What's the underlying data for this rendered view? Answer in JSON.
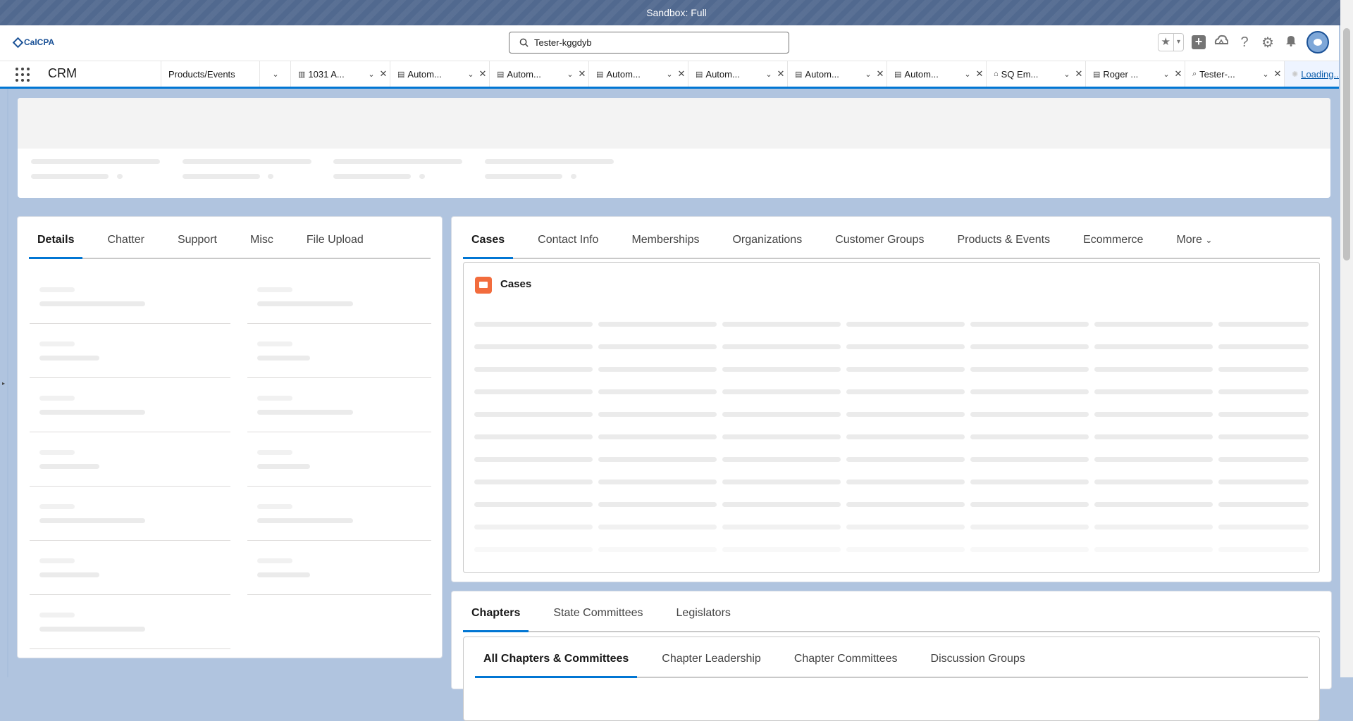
{
  "sandbox_banner": "Sandbox: Full",
  "header": {
    "logo_text": "CalCPA",
    "search_value": "Tester-kggdyb",
    "icons": [
      "favorites-star-icon",
      "favorites-dropdown-icon",
      "global-actions-plus-icon",
      "trailhead-icon",
      "help-icon",
      "setup-gear-icon",
      "notifications-bell-icon",
      "user-avatar"
    ]
  },
  "nav": {
    "app_name": "CRM",
    "nav_item": "Products/Events",
    "tabs": [
      {
        "label": "1031 A...",
        "icon": "building-icon"
      },
      {
        "label": "Autom...",
        "icon": "contact-card-icon"
      },
      {
        "label": "Autom...",
        "icon": "contact-card-icon"
      },
      {
        "label": "Autom...",
        "icon": "contact-card-icon"
      },
      {
        "label": "Autom...",
        "icon": "contact-card-icon"
      },
      {
        "label": "Autom...",
        "icon": "contact-card-icon"
      },
      {
        "label": "Autom...",
        "icon": "contact-card-icon"
      },
      {
        "label": "SQ Em...",
        "icon": "store-icon"
      },
      {
        "label": "Roger ...",
        "icon": "contact-card-icon"
      },
      {
        "label": "Tester-...",
        "icon": "search-icon"
      }
    ],
    "loading_tab": "Loading..."
  },
  "details_card": {
    "tabs": [
      "Details",
      "Chatter",
      "Support",
      "Misc",
      "File Upload"
    ],
    "active_tab": "Details"
  },
  "related_card": {
    "tabs": [
      "Cases",
      "Contact Info",
      "Memberships",
      "Organizations",
      "Customer Groups",
      "Products & Events",
      "Ecommerce"
    ],
    "more_label": "More",
    "active_tab": "Cases",
    "cases_title": "Cases"
  },
  "chapters_card": {
    "tabs": [
      "Chapters",
      "State Committees",
      "Legislators"
    ],
    "active_tab": "Chapters",
    "subtabs": [
      "All Chapters & Committees",
      "Chapter Leadership",
      "Chapter Committees",
      "Discussion Groups"
    ],
    "active_subtab": "All Chapters & Committees"
  },
  "colors": {
    "brand_blue": "#0176d3",
    "page_background": "#b0c4df",
    "sandbox_bar": "#51698f",
    "case_icon": "#f26c3d"
  }
}
